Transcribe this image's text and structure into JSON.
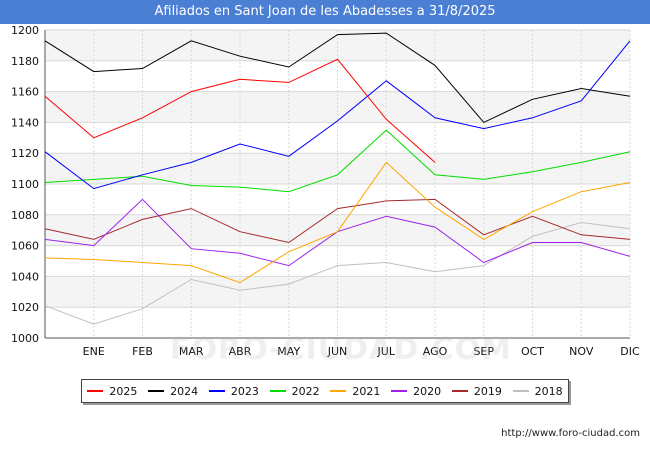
{
  "title": "Afiliados en Sant Joan de les Abadesses a 31/8/2025",
  "watermark": "FORO-CIUDAD.COM",
  "footer": "http://www.foro-ciudad.com",
  "chart_data": {
    "type": "line",
    "categories": [
      "",
      "ENE",
      "FEB",
      "MAR",
      "ABR",
      "MAY",
      "JUN",
      "JUL",
      "AGO",
      "SEP",
      "OCT",
      "NOV",
      "DIC"
    ],
    "ylim": [
      1000,
      1200
    ],
    "yticks": [
      1000,
      1020,
      1040,
      1060,
      1080,
      1100,
      1120,
      1140,
      1160,
      1180,
      1200
    ],
    "grid": true,
    "legend_position": "bottom",
    "series": [
      {
        "name": "2025",
        "color": "#ff0000",
        "values": [
          1157,
          1130,
          1143,
          1160,
          1168,
          1166,
          1181,
          1142,
          1114,
          null,
          null,
          null,
          null
        ]
      },
      {
        "name": "2024",
        "color": "#000000",
        "values": [
          1193,
          1173,
          1175,
          1193,
          1183,
          1176,
          1197,
          1198,
          1177,
          1140,
          1155,
          1162,
          1157
        ]
      },
      {
        "name": "2023",
        "color": "#0000ff",
        "values": [
          1121,
          1097,
          1106,
          1114,
          1126,
          1118,
          1141,
          1167,
          1143,
          1136,
          1143,
          1154,
          1193
        ]
      },
      {
        "name": "2022",
        "color": "#00dd00",
        "values": [
          1101,
          1103,
          1105,
          1099,
          1098,
          1095,
          1106,
          1135,
          1106,
          1103,
          1108,
          1114,
          1121
        ]
      },
      {
        "name": "2021",
        "color": "#ffa500",
        "values": [
          1052,
          1051,
          1049,
          1047,
          1036,
          1056,
          1069,
          1114,
          1085,
          1064,
          1082,
          1095,
          1101
        ]
      },
      {
        "name": "2020",
        "color": "#a020f0",
        "values": [
          1064,
          1060,
          1090,
          1058,
          1055,
          1047,
          1069,
          1079,
          1072,
          1049,
          1062,
          1062,
          1053
        ]
      },
      {
        "name": "2019",
        "color": "#a52a2a",
        "values": [
          1071,
          1064,
          1077,
          1084,
          1069,
          1062,
          1084,
          1089,
          1090,
          1067,
          1079,
          1067,
          1064
        ]
      },
      {
        "name": "2018",
        "color": "#c0c0c0",
        "values": [
          1021,
          1009,
          1019,
          1038,
          1031,
          1035,
          1047,
          1049,
          1043,
          1047,
          1066,
          1075,
          1071
        ]
      }
    ]
  }
}
